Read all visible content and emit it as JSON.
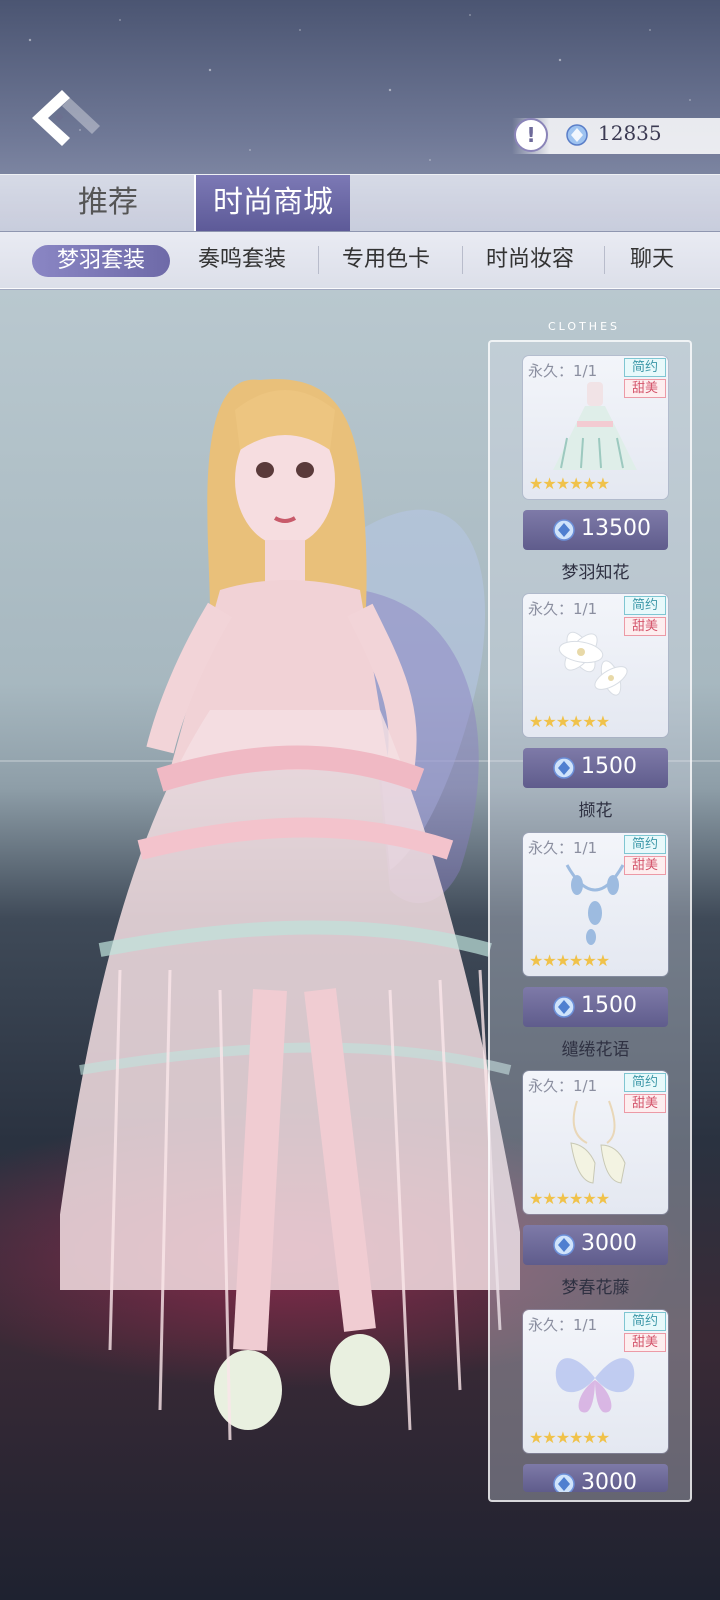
{
  "header": {
    "currency": {
      "value": "12835"
    }
  },
  "tabs": [
    {
      "label": "推荐"
    },
    {
      "label": "时尚商城"
    }
  ],
  "subtabs": [
    {
      "label": "梦羽套装"
    },
    {
      "label": "奏鸣套装"
    },
    {
      "label": "专用色卡"
    },
    {
      "label": "时尚妆容"
    },
    {
      "label": "聊天"
    }
  ],
  "list_title": "CLOTHES",
  "items": [
    {
      "permanence": "永久：1/1",
      "tag1": "简约",
      "tag2": "甜美",
      "stars": "★★★★★★",
      "price": "13500",
      "name": "梦羽知花"
    },
    {
      "permanence": "永久：1/1",
      "tag1": "简约",
      "tag2": "甜美",
      "stars": "★★★★★★",
      "price": "1500",
      "name": "撷花"
    },
    {
      "permanence": "永久：1/1",
      "tag1": "简约",
      "tag2": "甜美",
      "stars": "★★★★★★",
      "price": "1500",
      "name": "缱绻花语"
    },
    {
      "permanence": "永久：1/1",
      "tag1": "简约",
      "tag2": "甜美",
      "stars": "★★★★★★",
      "price": "3000",
      "name": "梦春花藤"
    },
    {
      "permanence": "永久：1/1",
      "tag1": "简约",
      "tag2": "甜美",
      "stars": "★★★★★★",
      "price": "3000",
      "name": ""
    }
  ]
}
